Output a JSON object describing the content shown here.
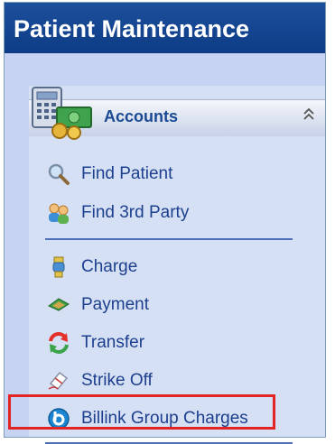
{
  "panel": {
    "title": "Patient Maintenance"
  },
  "group": {
    "title": "Accounts",
    "icon": "accounts-calculator-icon",
    "collapse_icon": "double-chevron-up-icon"
  },
  "items": [
    {
      "label": "Find Patient",
      "icon": "magnifier-icon"
    },
    {
      "label": "Find 3rd Party",
      "icon": "people-icon"
    },
    {
      "label": "Charge",
      "icon": "trophy-icon"
    },
    {
      "label": "Payment",
      "icon": "payment-icon"
    },
    {
      "label": "Transfer",
      "icon": "transfer-icon"
    },
    {
      "label": "Strike Off",
      "icon": "eraser-icon"
    },
    {
      "label": "Billink Group Charges",
      "icon": "billink-icon"
    }
  ]
}
